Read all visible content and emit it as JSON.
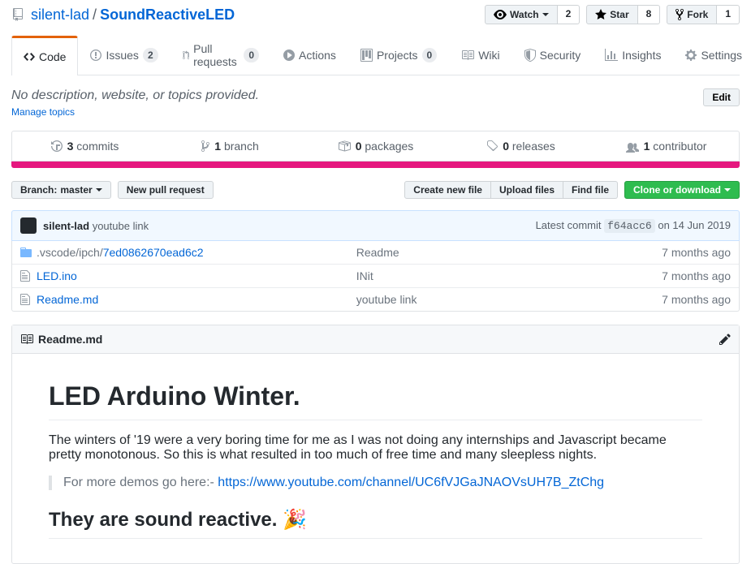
{
  "repo": {
    "owner": "silent-lad",
    "name": "SoundReactiveLED"
  },
  "actions": {
    "watch": {
      "label": "Watch",
      "count": "2"
    },
    "star": {
      "label": "Star",
      "count": "8"
    },
    "fork": {
      "label": "Fork",
      "count": "1"
    }
  },
  "tabs": {
    "code": "Code",
    "issues": {
      "label": "Issues",
      "count": "2"
    },
    "pulls": {
      "label": "Pull requests",
      "count": "0"
    },
    "actions": "Actions",
    "projects": {
      "label": "Projects",
      "count": "0"
    },
    "wiki": "Wiki",
    "security": "Security",
    "insights": "Insights",
    "settings": "Settings"
  },
  "about": {
    "desc": "No description, website, or topics provided.",
    "edit": "Edit",
    "manage": "Manage topics"
  },
  "summary": {
    "commits": {
      "n": "3",
      "label": "commits"
    },
    "branches": {
      "n": "1",
      "label": "branch"
    },
    "packages": {
      "n": "0",
      "label": "packages"
    },
    "releases": {
      "n": "0",
      "label": "releases"
    },
    "contributors": {
      "n": "1",
      "label": "contributor"
    }
  },
  "fileNav": {
    "branch": {
      "prefix": "Branch:",
      "name": "master"
    },
    "newPull": "New pull request",
    "createFile": "Create new file",
    "uploadFiles": "Upload files",
    "findFile": "Find file",
    "clone": "Clone or download"
  },
  "commit": {
    "author": "silent-lad",
    "message": "youtube link",
    "latest": "Latest commit",
    "sha": "f64acc6",
    "date": "on 14 Jun 2019"
  },
  "files": [
    {
      "type": "dir",
      "name": ".vscode/ipch/",
      "link": "7ed0862670ead6c2",
      "msg": "Readme",
      "age": "7 months ago"
    },
    {
      "type": "file",
      "name": "LED.ino",
      "msg": "INit",
      "age": "7 months ago"
    },
    {
      "type": "file",
      "name": "Readme.md",
      "msg": "youtube link",
      "age": "7 months ago"
    }
  ],
  "readme": {
    "filename": "Readme.md",
    "h1": "LED Arduino Winter.",
    "p1": "The winters of '19 were a very boring time for me as I was not doing any internships and Javascript became pretty monotonous. So this is what resulted in too much of free time and many sleepless nights.",
    "bqPrefix": "For more demos go here:- ",
    "bqLink": "https://www.youtube.com/channel/UC6fVJGaJNAOVsUH7B_ZtChg",
    "h2": "They are sound reactive. 🎉"
  }
}
